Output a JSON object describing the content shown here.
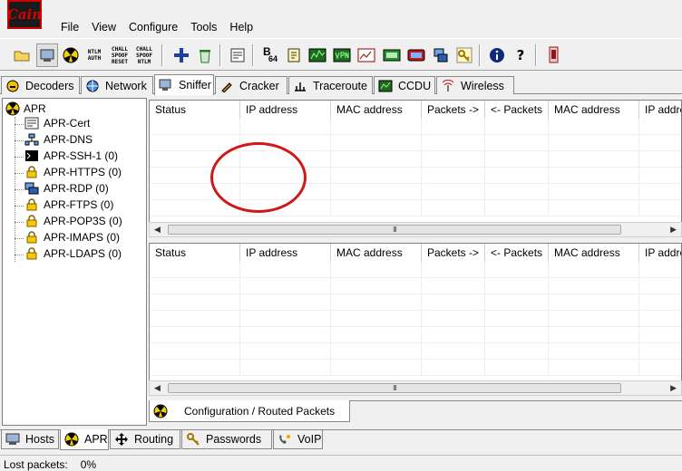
{
  "app": {
    "logo_text": "Cain"
  },
  "menu": [
    "File",
    "View",
    "Configure",
    "Tools",
    "Help"
  ],
  "toolbar": {
    "text_buttons": [
      {
        "name": "ntlm-auth-button",
        "lines": [
          "NTLM",
          "AUTH"
        ]
      },
      {
        "name": "chall-spoof-reset-button",
        "lines": [
          "CHALL",
          "SPOOF",
          "RESET"
        ]
      },
      {
        "name": "chall-spoof-ntlm-button",
        "lines": [
          "CHALL",
          "SPOOF",
          "NTLM"
        ]
      }
    ],
    "base64_label": "B",
    "base64_sub": "64"
  },
  "top_tabs": [
    "Decoders",
    "Network",
    "Sniffer",
    "Cracker",
    "Traceroute",
    "CCDU",
    "Wireless"
  ],
  "active_top_tab": "Sniffer",
  "tree": {
    "root": "APR",
    "items": [
      "APR-Cert",
      "APR-DNS",
      "APR-SSH-1 (0)",
      "APR-HTTPS (0)",
      "APR-RDP (0)",
      "APR-FTPS (0)",
      "APR-POP3S (0)",
      "APR-IMAPS (0)",
      "APR-LDAPS (0)"
    ]
  },
  "grid_top": {
    "columns": [
      "Status",
      "IP address",
      "MAC address",
      "Packets ->",
      "<- Packets",
      "MAC address",
      "IP address"
    ]
  },
  "grid_bottom": {
    "columns": [
      "Status",
      "IP address",
      "MAC address",
      "Packets ->",
      "<- Packets",
      "MAC address",
      "IP address"
    ]
  },
  "scroll_grip": "III",
  "subtab": {
    "label": "Configuration / Routed Packets"
  },
  "bottom_tabs": [
    "Hosts",
    "APR",
    "Routing",
    "Passwords",
    "VoIP"
  ],
  "active_bottom_tab": "APR",
  "status": {
    "label": "Lost packets:",
    "value": "0%"
  },
  "colors": {
    "annotation_circle": "#d01818",
    "logo_red": "#dd0000"
  }
}
